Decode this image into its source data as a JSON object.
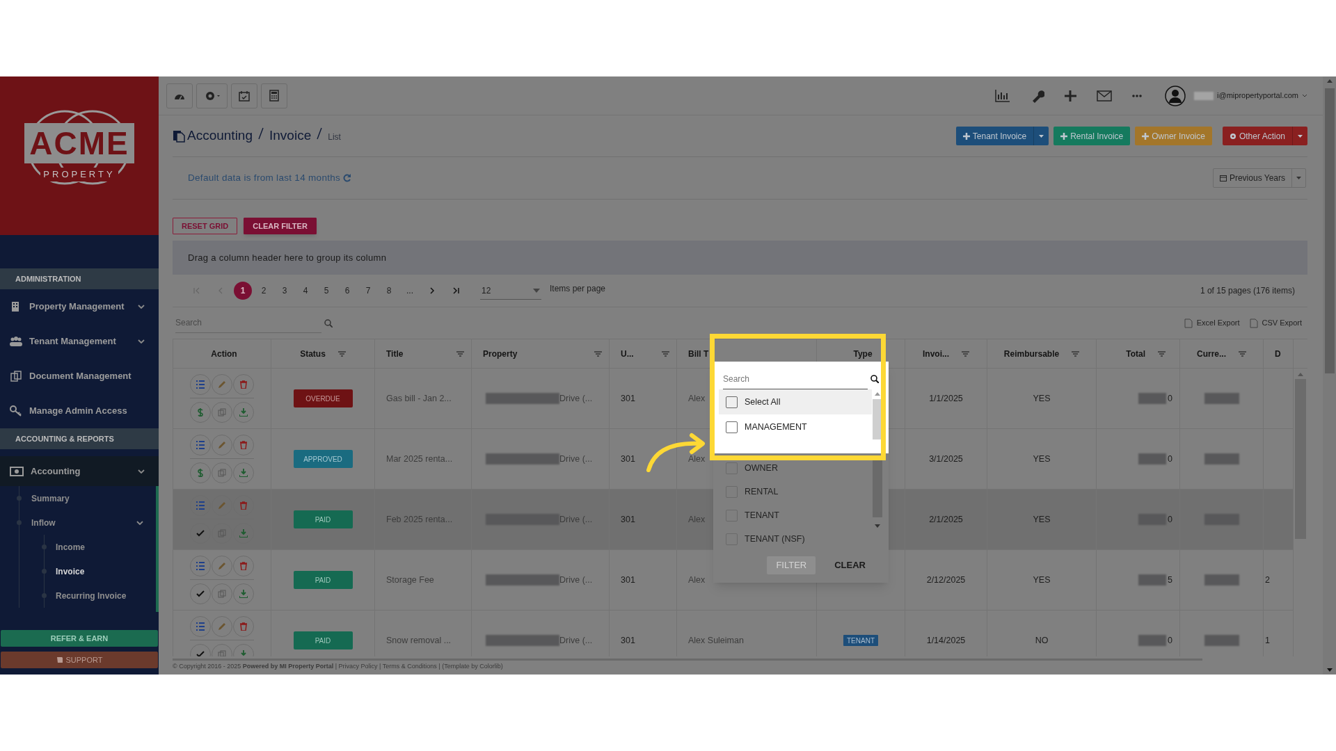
{
  "sidebar": {
    "logo": {
      "name": "ACME",
      "tagline": "PROPERTY"
    },
    "sections": [
      {
        "title": "ADMINISTRATION",
        "items": [
          {
            "label": "Property Management",
            "expandable": true,
            "selected": false
          },
          {
            "label": "Tenant Management",
            "expandable": true,
            "selected": false
          },
          {
            "label": "Document Management",
            "expandable": false,
            "selected": false
          },
          {
            "label": "Manage Admin Access",
            "expandable": false,
            "selected": false
          }
        ]
      },
      {
        "title": "ACCOUNTING & REPORTS",
        "items": [
          {
            "label": "Accounting",
            "expandable": true,
            "selected": true,
            "children": [
              {
                "label": "Summary",
                "selected": false,
                "expandable": false
              },
              {
                "label": "Inflow",
                "selected": false,
                "expandable": true,
                "children": [
                  {
                    "label": "Income",
                    "selected": false
                  },
                  {
                    "label": "Invoice",
                    "selected": true
                  },
                  {
                    "label": "Recurring Invoice",
                    "selected": false
                  }
                ]
              }
            ]
          }
        ]
      }
    ],
    "refer_button": "REFER & EARN",
    "support_button": "SUPPORT"
  },
  "top_bar": {
    "user_email": "i@mipropertyportal.com"
  },
  "breadcrumb": {
    "parts": [
      "Accounting",
      "Invoice"
    ],
    "current": "List"
  },
  "action_buttons": [
    {
      "label": "Tenant Invoice",
      "color": "#1d4e7a",
      "split": true
    },
    {
      "label": "Rental Invoice",
      "color": "#157a5e",
      "split": false
    },
    {
      "label": "Owner Invoice",
      "color": "#a3762a",
      "split": false
    },
    {
      "label": "Other Action",
      "color": "#8a2020",
      "split": true
    }
  ],
  "notice": "Default data is from last 14 months",
  "previous_years_button": "Previous Years",
  "grid_buttons": [
    {
      "label": "RESET GRID",
      "kind": "outline"
    },
    {
      "label": "CLEAR FILTER",
      "kind": "solid"
    }
  ],
  "group_hint": "Drag a column header here to group its column",
  "pager": {
    "pages": [
      {
        "label": "1",
        "selected": true
      },
      {
        "label": "2",
        "selected": false
      },
      {
        "label": "3",
        "selected": false
      },
      {
        "label": "4",
        "selected": false
      },
      {
        "label": "5",
        "selected": false
      },
      {
        "label": "6",
        "selected": false
      },
      {
        "label": "7",
        "selected": false
      },
      {
        "label": "8",
        "selected": false
      },
      {
        "label": "...",
        "selected": false
      }
    ],
    "page_size": "12",
    "page_size_label": "Items per page",
    "summary": "1 of 15 pages (176 items)"
  },
  "grid_search": {
    "placeholder": "Search"
  },
  "exports": [
    "Excel Export",
    "CSV Export"
  ],
  "columns": [
    {
      "label": "Action",
      "filter": false
    },
    {
      "label": "Status",
      "filter": true
    },
    {
      "label": "Title",
      "filter": true
    },
    {
      "label": "Property",
      "filter": true
    },
    {
      "label": "U...",
      "filter": true
    },
    {
      "label": "Bill T",
      "filter": false
    },
    {
      "label": "Type",
      "filter": false
    },
    {
      "label": "Invoi...",
      "filter": true
    },
    {
      "label": "Reimbursable",
      "filter": true
    },
    {
      "label": "Total",
      "filter": true
    },
    {
      "label": "Curre...",
      "filter": true
    },
    {
      "label": "D",
      "filter": false
    }
  ],
  "rows": [
    {
      "selected": false,
      "paid": false,
      "status": {
        "label": "OVERDUE",
        "kind": "overdue"
      },
      "title": "Gas bill - Jan 2...",
      "property": "Drive (...",
      "unit": "301",
      "bill_to": "Alex",
      "invoice_date": "1/1/2025",
      "reimbursable": "YES",
      "total": "0"
    },
    {
      "selected": false,
      "paid": false,
      "status": {
        "label": "APPROVED",
        "kind": "approved"
      },
      "title": "Mar 2025 renta...",
      "property": "Drive (...",
      "unit": "301",
      "bill_to": "Alex",
      "invoice_date": "3/1/2025",
      "reimbursable": "YES",
      "total": "0"
    },
    {
      "selected": true,
      "paid": true,
      "status": {
        "label": "PAID",
        "kind": "paid"
      },
      "title": "Feb 2025 renta...",
      "property": "Drive (...",
      "unit": "301",
      "bill_to": "Alex",
      "invoice_date": "2/1/2025",
      "reimbursable": "YES",
      "total": "0"
    },
    {
      "selected": false,
      "paid": true,
      "status": {
        "label": "PAID",
        "kind": "paid"
      },
      "title": "Storage Fee",
      "property": "Drive (...",
      "unit": "301",
      "bill_to": "Alex",
      "invoice_date": "2/12/2025",
      "reimbursable": "YES",
      "total": "5",
      "col_d": "2"
    },
    {
      "selected": false,
      "paid": true,
      "status": {
        "label": "PAID",
        "kind": "paid"
      },
      "title": "Snow removal ...",
      "property": "Drive (...",
      "unit": "301",
      "bill_to": "Alex Suleiman",
      "type": "TENANT",
      "invoice_date": "1/14/2025",
      "reimbursable": "NO",
      "total": "0",
      "col_d": "1"
    }
  ],
  "filter_popup": {
    "search": {
      "placeholder": "Search"
    },
    "options": [
      {
        "label": "Select All",
        "checked": false,
        "highlighted": true
      },
      {
        "label": "MANAGEMENT",
        "checked": false,
        "highlighted": false
      },
      {
        "label": "OWNER",
        "checked": false,
        "highlighted": false
      },
      {
        "label": "RENTAL",
        "checked": false,
        "highlighted": false
      },
      {
        "label": "TENANT",
        "checked": false,
        "highlighted": false
      },
      {
        "label": "TENANT (NSF)",
        "checked": false,
        "highlighted": false
      }
    ],
    "buttons": [
      {
        "label": "FILTER",
        "disabled": true
      },
      {
        "label": "CLEAR",
        "disabled": false
      }
    ]
  },
  "footer": "© Copyright 2016 - 2025 **Powered by MI Property Portal** | Privacy Policy | Terms & Conditions | (Template by Colorlib)"
}
